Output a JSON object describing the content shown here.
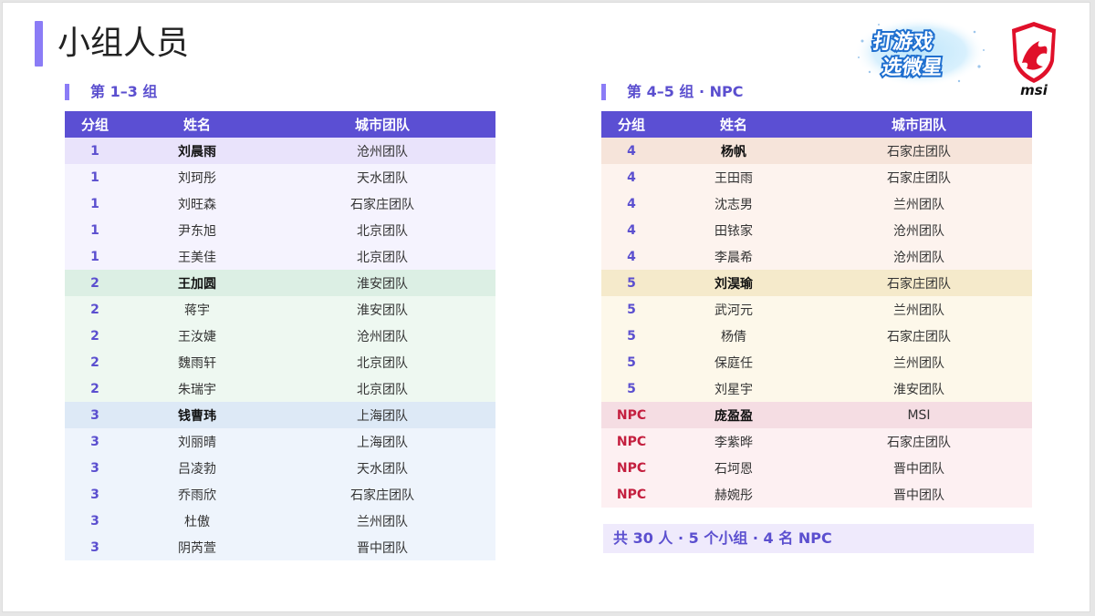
{
  "title": "小组人员",
  "left_section": "第 1–3 组",
  "right_section": "第 4–5 组 · NPC",
  "columns": [
    "分组",
    "姓名",
    "城市团队"
  ],
  "left_rows": [
    {
      "g": "1",
      "n": "刘晨雨",
      "c": "沧州团队",
      "lead": true,
      "bg": "#e9e3fb"
    },
    {
      "g": "1",
      "n": "刘珂彤",
      "c": "天水团队",
      "bg": "#f5f3fe"
    },
    {
      "g": "1",
      "n": "刘旺森",
      "c": "石家庄团队",
      "bg": "#f5f3fe"
    },
    {
      "g": "1",
      "n": "尹东旭",
      "c": "北京团队",
      "bg": "#f5f3fe"
    },
    {
      "g": "1",
      "n": "王美佳",
      "c": "北京团队",
      "bg": "#f5f3fe"
    },
    {
      "g": "2",
      "n": "王加圆",
      "c": "淮安团队",
      "lead": true,
      "bg": "#dcefe4"
    },
    {
      "g": "2",
      "n": "蒋宇",
      "c": "淮安团队",
      "bg": "#eef8f1"
    },
    {
      "g": "2",
      "n": "王汝婕",
      "c": "沧州团队",
      "bg": "#eef8f1"
    },
    {
      "g": "2",
      "n": "魏雨轩",
      "c": "北京团队",
      "bg": "#eef8f1"
    },
    {
      "g": "2",
      "n": "朱瑞宇",
      "c": "北京团队",
      "bg": "#eef8f1"
    },
    {
      "g": "3",
      "n": "钱曹玮",
      "c": "上海团队",
      "lead": true,
      "bg": "#dde9f6"
    },
    {
      "g": "3",
      "n": "刘丽晴",
      "c": "上海团队",
      "bg": "#eef4fc"
    },
    {
      "g": "3",
      "n": "吕凌勃",
      "c": "天水团队",
      "bg": "#eef4fc"
    },
    {
      "g": "3",
      "n": "乔雨欣",
      "c": "石家庄团队",
      "bg": "#eef4fc"
    },
    {
      "g": "3",
      "n": "杜傲",
      "c": "兰州团队",
      "bg": "#eef4fc"
    },
    {
      "g": "3",
      "n": "阴芮萱",
      "c": "晋中团队",
      "bg": "#eef4fc"
    }
  ],
  "right_rows": [
    {
      "g": "4",
      "n": "杨帆",
      "c": "石家庄团队",
      "lead": true,
      "bg": "#f6e4da"
    },
    {
      "g": "4",
      "n": "王田雨",
      "c": "石家庄团队",
      "bg": "#fdf3ee"
    },
    {
      "g": "4",
      "n": "沈志男",
      "c": "兰州团队",
      "bg": "#fdf3ee"
    },
    {
      "g": "4",
      "n": "田铱家",
      "c": "沧州团队",
      "bg": "#fdf3ee"
    },
    {
      "g": "4",
      "n": "李晨希",
      "c": "沧州团队",
      "bg": "#fdf3ee"
    },
    {
      "g": "5",
      "n": "刘淏瑜",
      "c": "石家庄团队",
      "lead": true,
      "bg": "#f5eacb"
    },
    {
      "g": "5",
      "n": "武河元",
      "c": "兰州团队",
      "bg": "#fdf8ea"
    },
    {
      "g": "5",
      "n": "杨倩",
      "c": "石家庄团队",
      "bg": "#fdf8ea"
    },
    {
      "g": "5",
      "n": "保庭任",
      "c": "兰州团队",
      "bg": "#fdf8ea"
    },
    {
      "g": "5",
      "n": "刘星宇",
      "c": "淮安团队",
      "bg": "#fdf8ea"
    },
    {
      "g": "NPC",
      "n": "庞盈盈",
      "c": "MSI",
      "lead": true,
      "npc": true,
      "bg": "#f5dde3"
    },
    {
      "g": "NPC",
      "n": "李紫晔",
      "c": "石家庄团队",
      "npc": true,
      "bg": "#fdf0f2"
    },
    {
      "g": "NPC",
      "n": "石坷恩",
      "c": "晋中团队",
      "npc": true,
      "bg": "#fdf0f2"
    },
    {
      "g": "NPC",
      "n": "赫婉彤",
      "c": "晋中团队",
      "npc": true,
      "bg": "#fdf0f2"
    }
  ],
  "summary": "共 30 人 · 5 个小组 · 4 名 NPC",
  "badge": {
    "line1": "打游戏",
    "line2": "选微星"
  },
  "logo_text": "msi",
  "colors": {
    "accent": "#5b4fd3",
    "npc": "#c41f3f",
    "msi_red": "#e0102a"
  }
}
